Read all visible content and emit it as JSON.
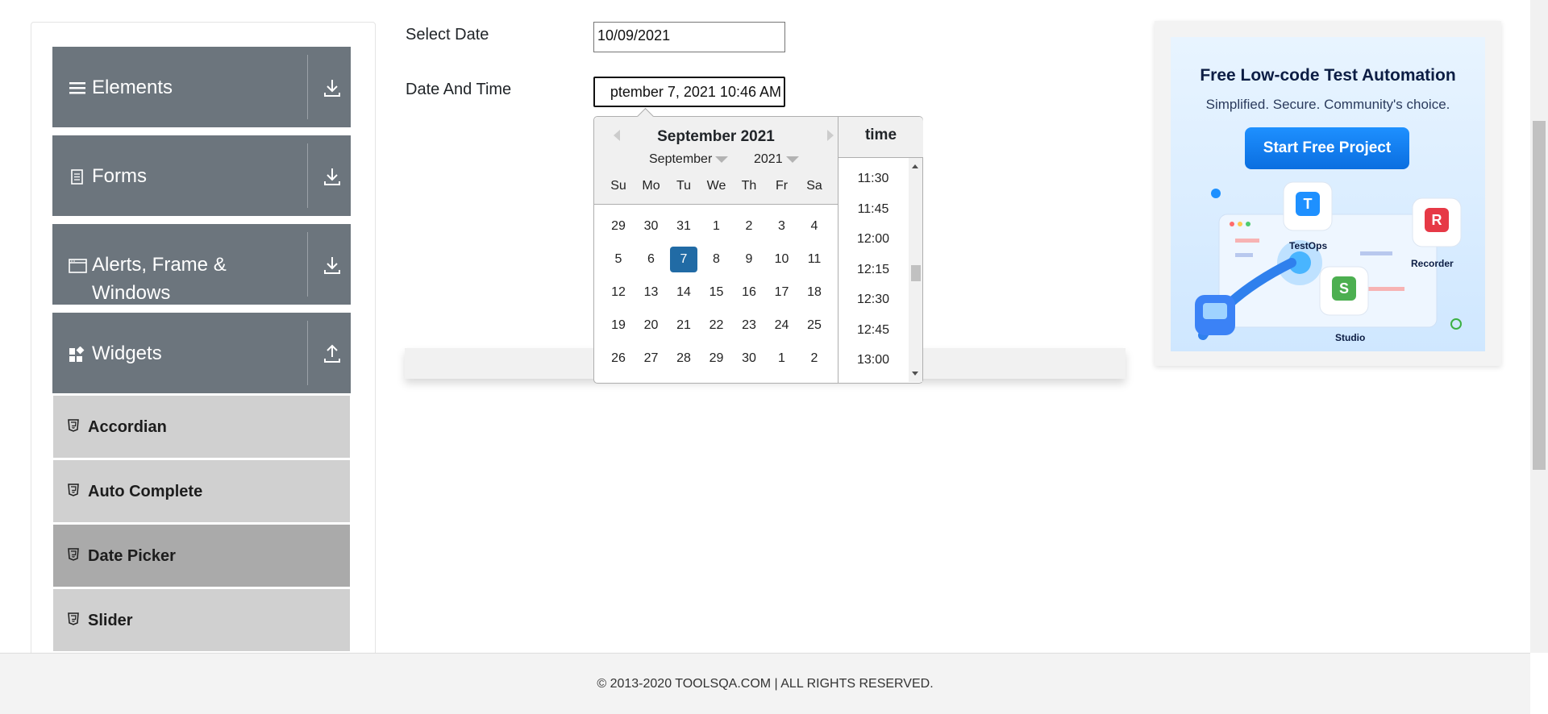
{
  "sidebar": {
    "groups": [
      {
        "label": "Elements",
        "icon": "menu-icon",
        "arrow": "download-icon"
      },
      {
        "label": "Forms",
        "icon": "document-icon",
        "arrow": "download-icon"
      },
      {
        "label": "Alerts, Frame &",
        "label2": "Windows",
        "icon": "window-icon",
        "arrow": "download-icon"
      },
      {
        "label": "Widgets",
        "icon": "widgets-icon",
        "arrow": "upload-icon"
      }
    ],
    "items": [
      {
        "label": "Accordian",
        "active": false
      },
      {
        "label": "Auto Complete",
        "active": false
      },
      {
        "label": "Date Picker",
        "active": true
      },
      {
        "label": "Slider",
        "active": false
      }
    ]
  },
  "form": {
    "select_date_label": "Select Date",
    "select_date_value": "10/09/2021",
    "date_time_label": "Date And Time",
    "date_time_value": "ptember 7, 2021 10:46 AM"
  },
  "picker": {
    "title": "September 2021",
    "month_dropdown": "September",
    "year_dropdown": "2021",
    "weekdays": [
      "Su",
      "Mo",
      "Tu",
      "We",
      "Th",
      "Fr",
      "Sa"
    ],
    "weeks": [
      [
        "29",
        "30",
        "31",
        "1",
        "2",
        "3",
        "4"
      ],
      [
        "5",
        "6",
        "7",
        "8",
        "9",
        "10",
        "11"
      ],
      [
        "12",
        "13",
        "14",
        "15",
        "16",
        "17",
        "18"
      ],
      [
        "19",
        "20",
        "21",
        "22",
        "23",
        "24",
        "25"
      ],
      [
        "26",
        "27",
        "28",
        "29",
        "30",
        "1",
        "2"
      ]
    ],
    "selected_day": "7",
    "time_header": "time",
    "times": [
      "11:30",
      "11:45",
      "12:00",
      "12:15",
      "12:30",
      "12:45",
      "13:00"
    ]
  },
  "ad": {
    "title": "Free Low-code Test Automation",
    "subtitle": "Simplified. Secure. Community's choice.",
    "button": "Start Free Project",
    "products": [
      "TestOps",
      "Recorder",
      "Studio"
    ]
  },
  "footer": {
    "text": "© 2013-2020 TOOLSQA.COM | ALL RIGHTS RESERVED."
  },
  "colors": {
    "sidebar_header": "#6c757d",
    "menu_item": "#d0d0d0",
    "menu_item_active": "#aaaaaa",
    "selected_day": "#216ba5",
    "ad_button": "#1e90ff"
  }
}
